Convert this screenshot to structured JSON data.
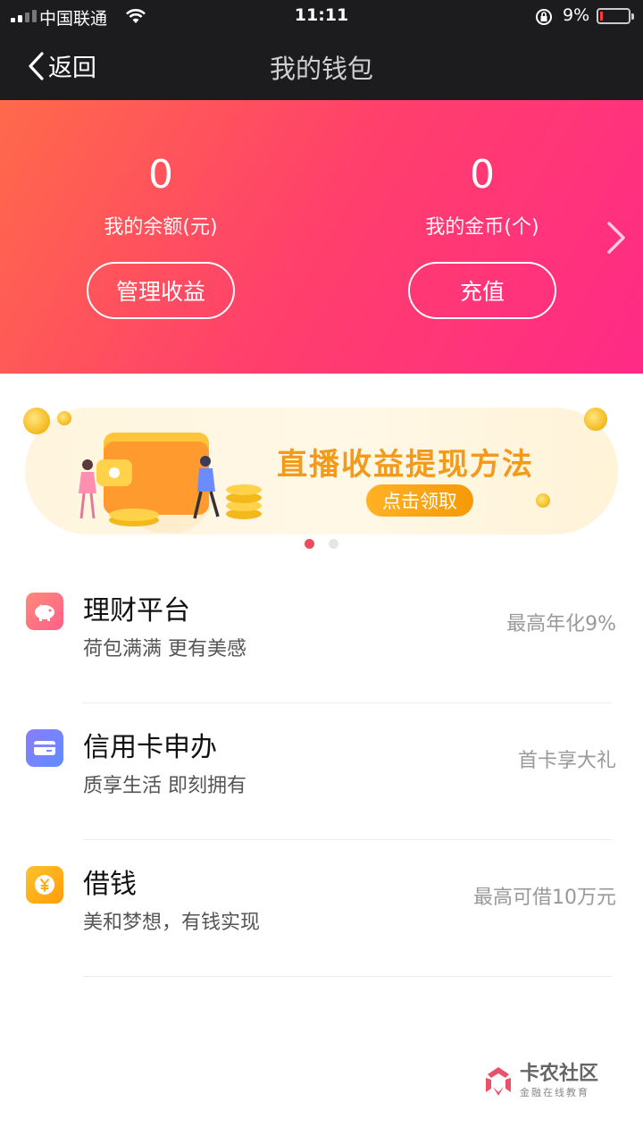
{
  "status_bar": {
    "carrier": "中国联通",
    "time": "11:11",
    "battery_percent": "9%",
    "battery_level": 0.09
  },
  "nav": {
    "back_label": "返回",
    "title": "我的钱包"
  },
  "wallet": {
    "balance": {
      "value": "0",
      "label": "我的余额(元)"
    },
    "coins": {
      "value": "0",
      "label": "我的金币(个)"
    },
    "manage_button": "管理收益",
    "recharge_button": "充值"
  },
  "banner": {
    "title": "直播收益提现方法",
    "button": "点击领取",
    "page_count": 2,
    "active_page": 1
  },
  "services": [
    {
      "icon": "piggy-bank-icon",
      "title": "理财平台",
      "subtitle": "荷包满满 更有美感",
      "tag": "最高年化9%",
      "color_from": "#ff8a7a",
      "color_to": "#ff5f8a"
    },
    {
      "icon": "credit-card-icon",
      "title": "信用卡申办",
      "subtitle": "质享生活 即刻拥有",
      "tag": "首卡享大礼",
      "color_from": "#8a7dff",
      "color_to": "#5f8cff"
    },
    {
      "icon": "yuan-coin-icon",
      "title": "借钱",
      "subtitle": "美和梦想，有钱实现",
      "tag": "最高可借10万元",
      "color_from": "#ffc22a",
      "color_to": "#ff9d0a"
    }
  ],
  "watermark": {
    "name": "卡农社区",
    "tagline": "金融在线教育"
  }
}
